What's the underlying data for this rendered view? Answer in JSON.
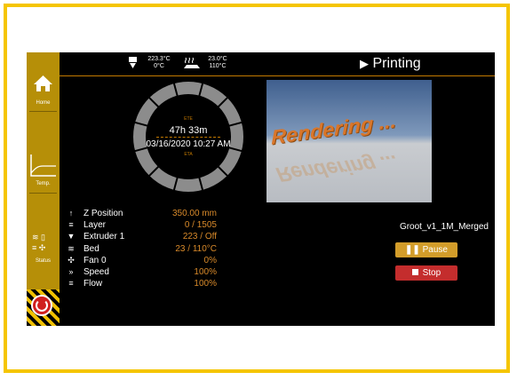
{
  "topbar": {
    "extruder_temp": "223.3°C",
    "extruder_target": "0°C",
    "bed_temp": "23.0°C",
    "bed_target": "110°C",
    "status": "Printing"
  },
  "sidebar": {
    "home_label": "Home",
    "temp_label": "Temp.",
    "status_label": "Status"
  },
  "progress": {
    "ete_label": "ETE",
    "remaining": "47h 33m",
    "eta_datetime": "03/16/2020 10:27 AM",
    "eta_label": "ETA"
  },
  "thumbnail": {
    "text": "Rendering ..."
  },
  "stats": [
    {
      "icon": "z-arrow-icon",
      "label": "Z Position",
      "value": "350.00 mm"
    },
    {
      "icon": "layers-icon",
      "label": "Layer",
      "value": "0 / 1505"
    },
    {
      "icon": "extruder-icon",
      "label": "Extruder 1",
      "value": "223 / Off"
    },
    {
      "icon": "bed-icon",
      "label": "Bed",
      "value": "23 / 110°C"
    },
    {
      "icon": "fan-icon",
      "label": "Fan 0",
      "value": "0%"
    },
    {
      "icon": "speed-icon",
      "label": "Speed",
      "value": "100%"
    },
    {
      "icon": "flow-icon",
      "label": "Flow",
      "value": "100%"
    }
  ],
  "job": {
    "filename": "Groot_v1_1M_Merged",
    "pause_label": "Pause",
    "stop_label": "Stop"
  },
  "colors": {
    "frame": "#f5c500",
    "sidebar": "#b68f08",
    "accent_value": "#d98a2a",
    "pause": "#d39d2a",
    "stop": "#c42d2d"
  }
}
